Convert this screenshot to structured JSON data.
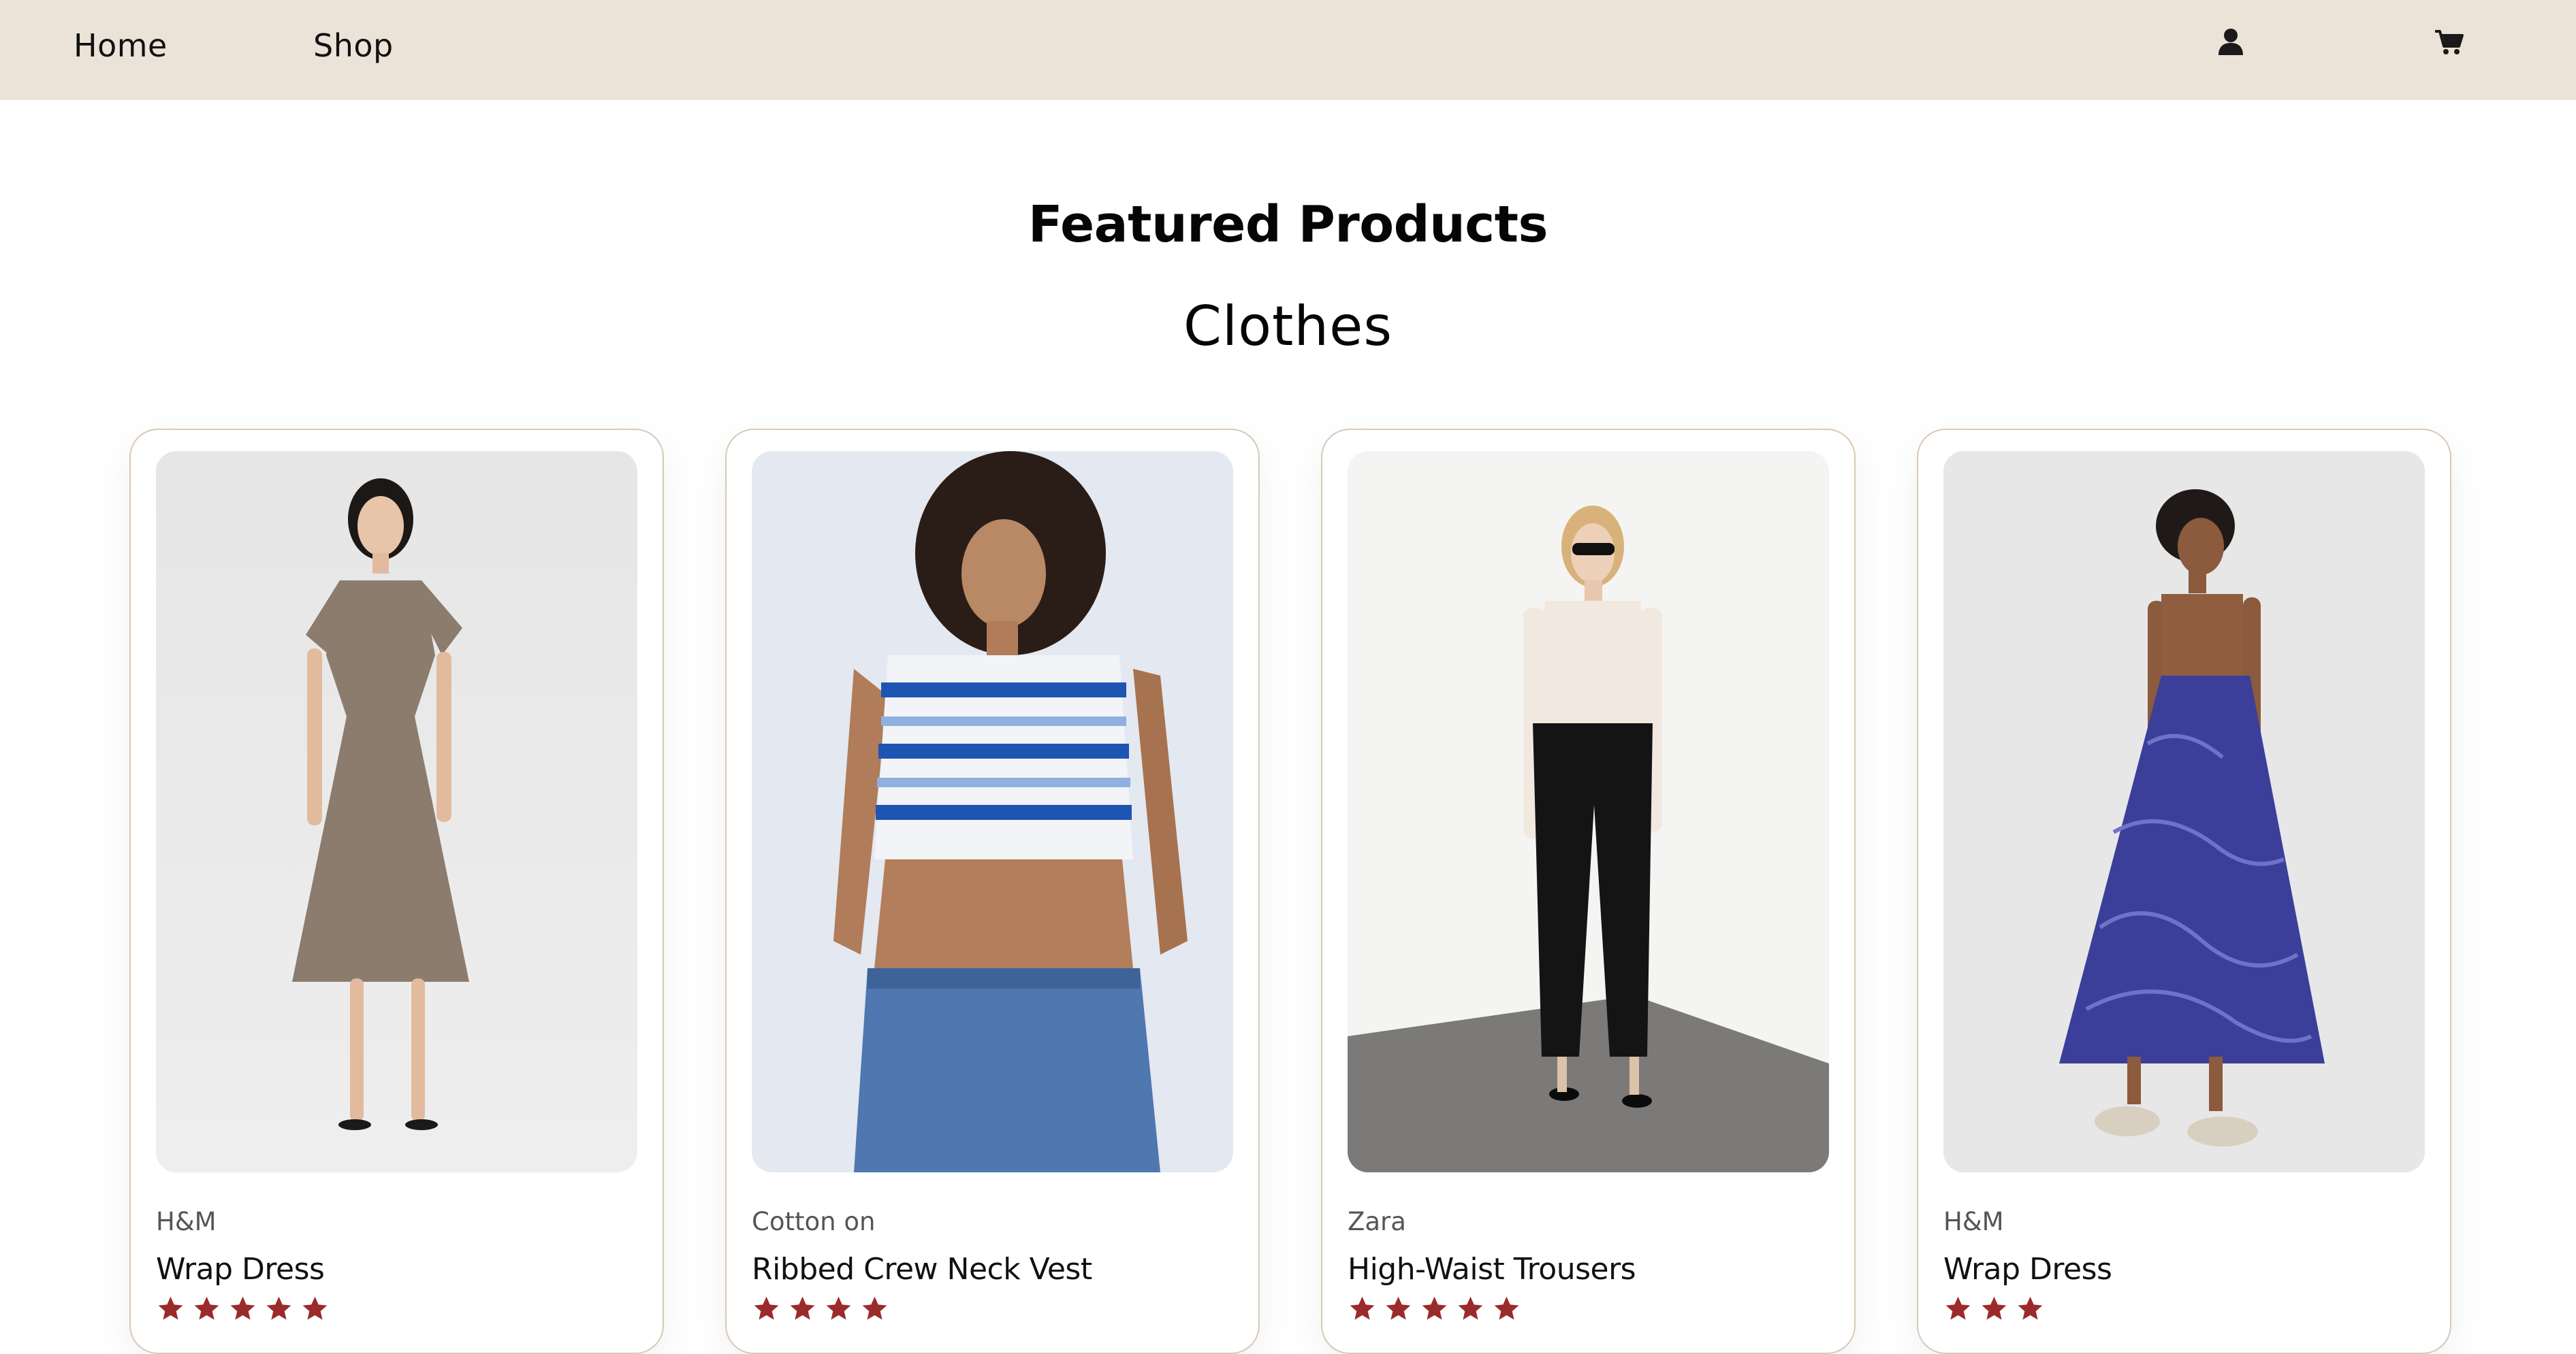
{
  "header": {
    "nav": [
      {
        "label": "Home"
      },
      {
        "label": "Shop"
      }
    ],
    "icons": [
      "user-icon",
      "cart-icon"
    ],
    "background": "#ece3d8"
  },
  "main": {
    "title": "Featured Products",
    "section": "Clothes"
  },
  "products": [
    {
      "brand": "H&M",
      "name": "Wrap Dress",
      "rating": 5,
      "image": "woman-in-taupe-wrap-dress"
    },
    {
      "brand": "Cotton on",
      "name": "Ribbed Crew Neck Vest",
      "rating": 4,
      "image": "woman-in-striped-crop-vest-and-jeans"
    },
    {
      "brand": "Zara",
      "name": "High-Waist Trousers",
      "rating": 5,
      "image": "woman-in-black-high-waist-trousers"
    },
    {
      "brand": "H&M",
      "name": "Wrap Dress",
      "rating": 3,
      "image": "woman-in-blue-patterned-dress"
    }
  ],
  "colors": {
    "accent": "#ece3d8",
    "card_border": "#d8c9b6",
    "star": "#9b2b2b"
  }
}
